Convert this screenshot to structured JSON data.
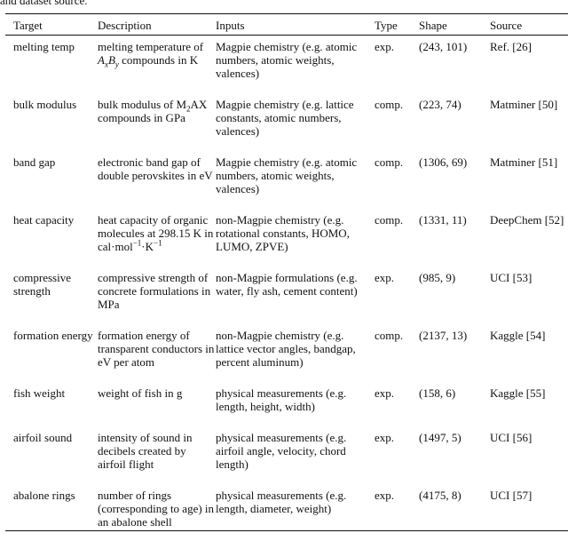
{
  "caption_fragment": "and dataset source.",
  "table": {
    "headers": {
      "target": "Target",
      "description": "Description",
      "inputs": "Inputs",
      "type": "Type",
      "shape": "Shape",
      "source": "Source"
    },
    "rows": [
      {
        "target": "melting temp",
        "description_pre": "melting temperature of ",
        "description_math": {
          "A": "A",
          "x": "x",
          "B": "B",
          "y": "y"
        },
        "description_post": " compounds in K",
        "inputs": "Magpie chemistry (e.g. atomic numbers, atomic weights, valences)",
        "type": "exp.",
        "shape": "(243, 101)",
        "source": "Ref. [26]"
      },
      {
        "target": "bulk modulus",
        "description_pre": "bulk modulus of M",
        "description_sub": "2",
        "description_post": "AX compounds in GPa",
        "inputs": "Magpie chemistry (e.g. lattice constants, atomic numbers, valences)",
        "type": "comp.",
        "shape": "(223, 74)",
        "source": "Matminer [50]"
      },
      {
        "target": "band gap",
        "description": "electronic band gap of double perovskites in eV",
        "inputs": "Magpie chemistry (e.g. atomic numbers, atomic weights, valences)",
        "type": "comp.",
        "shape": "(1306, 69)",
        "source": "Matminer [51]"
      },
      {
        "target": "heat capacity",
        "description_pre": "heat capacity of organic molecules at 298.15 K in cal·mol",
        "description_sup1": "−1",
        "description_mid": "·K",
        "description_sup2": "−1",
        "inputs": "non-Magpie chemistry (e.g. rotational constants, HOMO, LUMO, ZPVE)",
        "type": "comp.",
        "shape": "(1331, 11)",
        "source": "DeepChem [52]"
      },
      {
        "target": "compressive strength",
        "description": "compressive strength of concrete formulations in MPa",
        "inputs": "non-Magpie formulations (e.g. water, fly ash, cement content)",
        "type": "exp.",
        "shape": "(985, 9)",
        "source": "UCI [53]"
      },
      {
        "target": "formation energy",
        "description": "formation energy of transparent conductors in eV per atom",
        "inputs": "non-Magpie chemistry (e.g. lattice vector angles, bandgap, percent aluminum)",
        "type": "comp.",
        "shape": "(2137, 13)",
        "source": "Kaggle [54]"
      },
      {
        "target": "fish weight",
        "description": "weight of fish in g",
        "inputs": "physical measurements (e.g. length, height, width)",
        "type": "exp.",
        "shape": "(158, 6)",
        "source": "Kaggle [55]"
      },
      {
        "target": "airfoil sound",
        "description": "intensity of sound in decibels created by airfoil flight",
        "inputs": "physical measurements (e.g. airfoil angle, velocity, chord length)",
        "type": "exp.",
        "shape": "(1497, 5)",
        "source": "UCI [56]"
      },
      {
        "target": "abalone rings",
        "description": "number of rings (corresponding to age) in an abalone shell",
        "inputs": "physical measurements (e.g. length, diameter, weight)",
        "type": "exp.",
        "shape": "(4175, 8)",
        "source": "UCI [57]"
      }
    ]
  }
}
